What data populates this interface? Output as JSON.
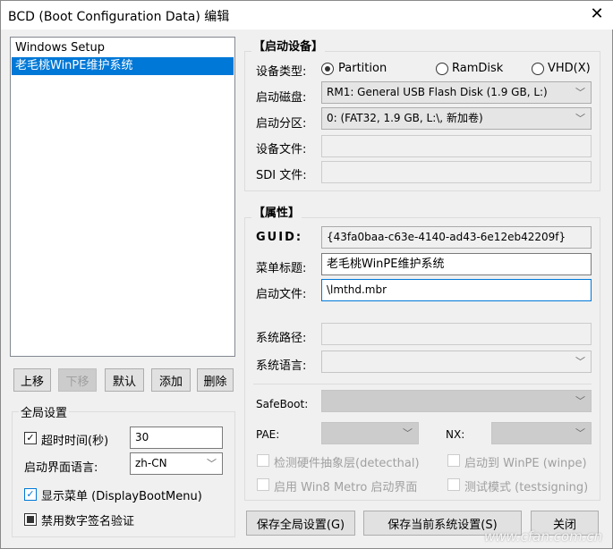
{
  "window": {
    "title": "BCD (Boot Configuration Data) 编辑",
    "close": "✕"
  },
  "entries": [
    {
      "label": "Windows Setup"
    },
    {
      "label": "老毛桃WinPE维护系统"
    }
  ],
  "list_buttons": {
    "up": "上移",
    "down": "下移",
    "default": "默认",
    "add": "添加",
    "delete": "删除"
  },
  "global": {
    "legend": "全局设置",
    "timeout_label": "超时时间(秒)",
    "timeout_value": "30",
    "lang_label": "启动界面语言:",
    "lang_value": "zh-CN",
    "display_menu": "显示菜单 (DisplayBootMenu)",
    "disable_sig": "禁用数字签名验证"
  },
  "device": {
    "legend": "【启动设备】",
    "type_label": "设备类型:",
    "types": [
      "Partition",
      "RamDisk",
      "VHD(X)"
    ],
    "disk_label": "启动磁盘:",
    "disk_value": "RM1: General USB Flash Disk (1.9 GB, L:)",
    "partition_label": "启动分区:",
    "partition_value": "0: (FAT32,  1.9 GB, L:\\, 新加卷)",
    "device_file_label": "设备文件:",
    "sdi_label": "SDI 文件:"
  },
  "props": {
    "legend": "【属性】",
    "guid_label": "GUID:",
    "guid_value": "{43fa0baa-c63e-4140-ad43-6e12eb42209f}",
    "menu_title_label": "菜单标题:",
    "menu_title_value": "老毛桃WinPE维护系统",
    "boot_file_label": "启动文件:",
    "boot_file_value": "\\lmthd.mbr",
    "sys_path_label": "系统路径:",
    "sys_lang_label": "系统语言:",
    "safeboot_label": "SafeBoot:",
    "pae_label": "PAE:",
    "nx_label": "NX:",
    "detecthal": "检测硬件抽象层(detecthal)",
    "winpe": "启动到 WinPE (winpe)",
    "metro": "启用 Win8 Metro 启动界面",
    "testsigning": "测试模式 (testsigning)"
  },
  "bottom": {
    "save_global": "保存全局设置(G)",
    "save_current": "保存当前系统设置(S)",
    "close": "关闭"
  },
  "watermark": "www.cfan.com.cn"
}
